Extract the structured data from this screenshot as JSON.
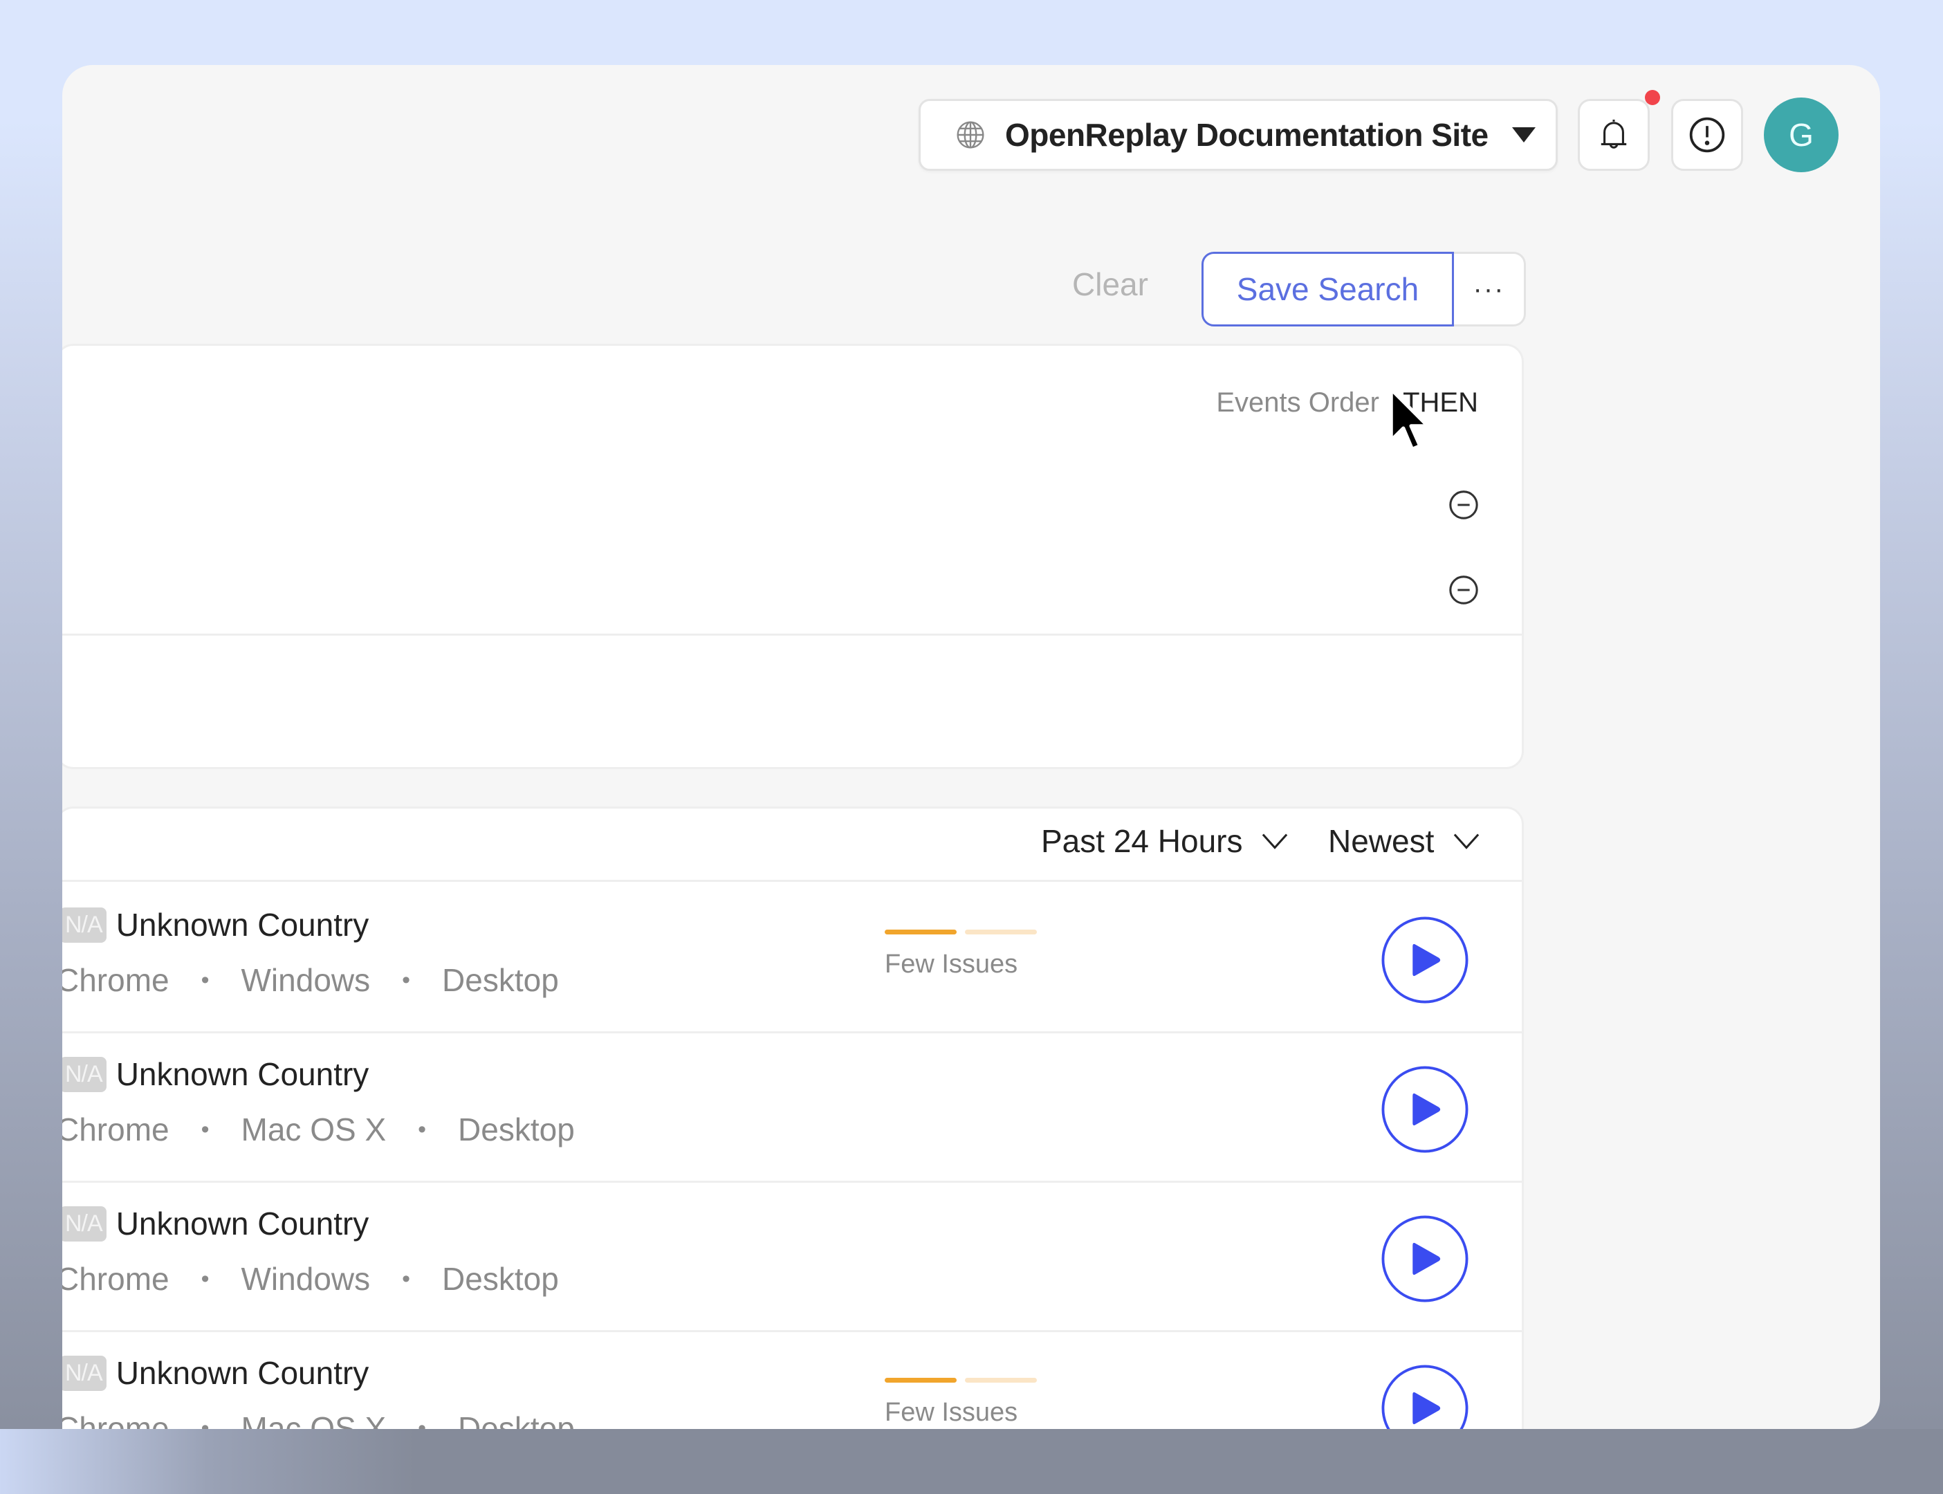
{
  "header": {
    "project_name": "OpenReplay Documentation Site",
    "project_icon": "globe-icon",
    "notifications_icon": "bell-icon",
    "has_unread_notifications": true,
    "info_icon": "exclamation-circle-icon",
    "avatar_initial": "G"
  },
  "search_actions": {
    "clear_label": "Clear",
    "save_search_label": "Save Search",
    "more_label": "···"
  },
  "filters": {
    "events_order_label": "Events Order",
    "events_order_value": "THEN",
    "filter_rows": [
      {
        "remove_icon": "minus-circle-icon"
      },
      {
        "remove_icon": "minus-circle-icon"
      }
    ]
  },
  "sessions": {
    "period_label": "Past 24 Hours",
    "sort_label": "Newest",
    "rows": [
      {
        "country_code": "N/A",
        "country": "Unknown Country",
        "browser": "Chrome",
        "os": "Windows",
        "device": "Desktop",
        "issues_label": "Few Issues",
        "issue_level": 1,
        "issue_levels_total": 2
      },
      {
        "country_code": "N/A",
        "country": "Unknown Country",
        "browser": "Chrome",
        "os": "Mac OS X",
        "device": "Desktop",
        "issues_label": "",
        "issue_level": 0,
        "issue_levels_total": 0
      },
      {
        "country_code": "N/A",
        "country": "Unknown Country",
        "browser": "Chrome",
        "os": "Windows",
        "device": "Desktop",
        "issues_label": "",
        "issue_level": 0,
        "issue_levels_total": 0
      },
      {
        "country_code": "N/A",
        "country": "Unknown Country",
        "browser": "Chrome",
        "os": "Mac OS X",
        "device": "Desktop",
        "issues_label": "Few Issues",
        "issue_level": 1,
        "issue_levels_total": 2
      }
    ],
    "meta_separator": "•"
  },
  "colors": {
    "accent": "#5b6fe0",
    "play": "#3a4cf0",
    "issue_active": "#f1a52c",
    "issue_inactive": "#fbe5c6",
    "notification_dot": "#f1444b",
    "avatar_bg": "#3ea9ab"
  }
}
